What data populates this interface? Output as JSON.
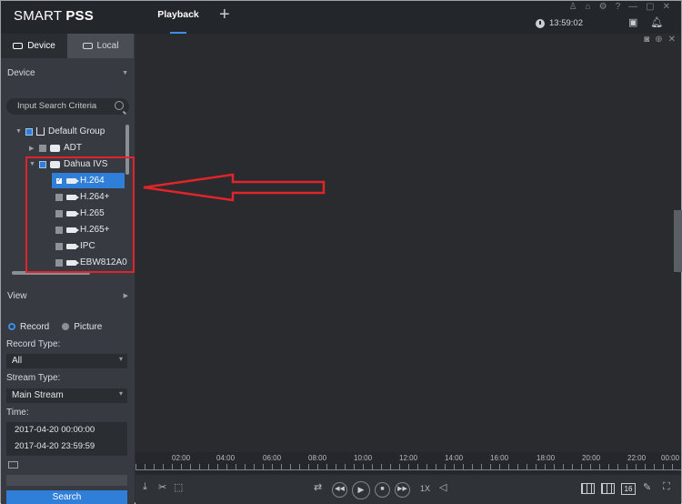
{
  "titlebar": {
    "brand_plain": "SMART ",
    "brand_bold": "PSS",
    "active_tab": "Playback",
    "add_tab": "+",
    "clock": "13:59:02",
    "window_icons": [
      "user-icon",
      "lock-icon",
      "gear-icon",
      "help-icon",
      "minimize-icon",
      "maximize-icon",
      "close-icon"
    ],
    "window_glyphs": [
      "♙",
      "⌂",
      "⚙",
      "?",
      "—",
      "▢",
      "✕"
    ]
  },
  "left": {
    "tabs": [
      {
        "label": "Device",
        "icon": "device-icon",
        "active": true
      },
      {
        "label": "Local",
        "icon": "monitor-icon",
        "active": false
      }
    ],
    "device_header": "Device",
    "search_placeholder": "Input Search Criteria",
    "tree": [
      {
        "label": "Default Group",
        "level": 0,
        "arrow": "▼",
        "type": "group"
      },
      {
        "label": "ADT",
        "level": 1,
        "arrow": "▶",
        "type": "device"
      },
      {
        "label": "Dahua IVS",
        "level": 1,
        "arrow": "▼",
        "type": "device"
      },
      {
        "label": "H.264",
        "level": 2,
        "type": "channel",
        "selected": true
      },
      {
        "label": "H.264+",
        "level": 2,
        "type": "channel"
      },
      {
        "label": "H.265",
        "level": 2,
        "type": "channel"
      },
      {
        "label": "H.265+",
        "level": 2,
        "type": "channel"
      },
      {
        "label": "IPC",
        "level": 2,
        "type": "channel"
      },
      {
        "label": "EBW812A0",
        "level": 2,
        "type": "channel"
      }
    ],
    "view_header": "View",
    "record_option": "Record",
    "picture_option": "Picture",
    "record_type_label": "Record Type:",
    "record_type_value": "All",
    "stream_type_label": "Stream Type:",
    "stream_type_value": "Main Stream",
    "time_label": "Time:",
    "time_start": "2017-04-20 00:00:00",
    "time_end": "2017-04-20 23:59:59",
    "search_button": "Search"
  },
  "timeline": {
    "labels": [
      "02:00",
      "04:00",
      "06:00",
      "08:00",
      "10:00",
      "12:00",
      "14:00",
      "16:00",
      "18:00",
      "20:00",
      "22:00",
      "00:00"
    ]
  },
  "bottombar": {
    "speed": "1X",
    "split_count": "16"
  },
  "colors": {
    "accent": "#2f7ed8",
    "annotation_red": "#e0242a"
  }
}
